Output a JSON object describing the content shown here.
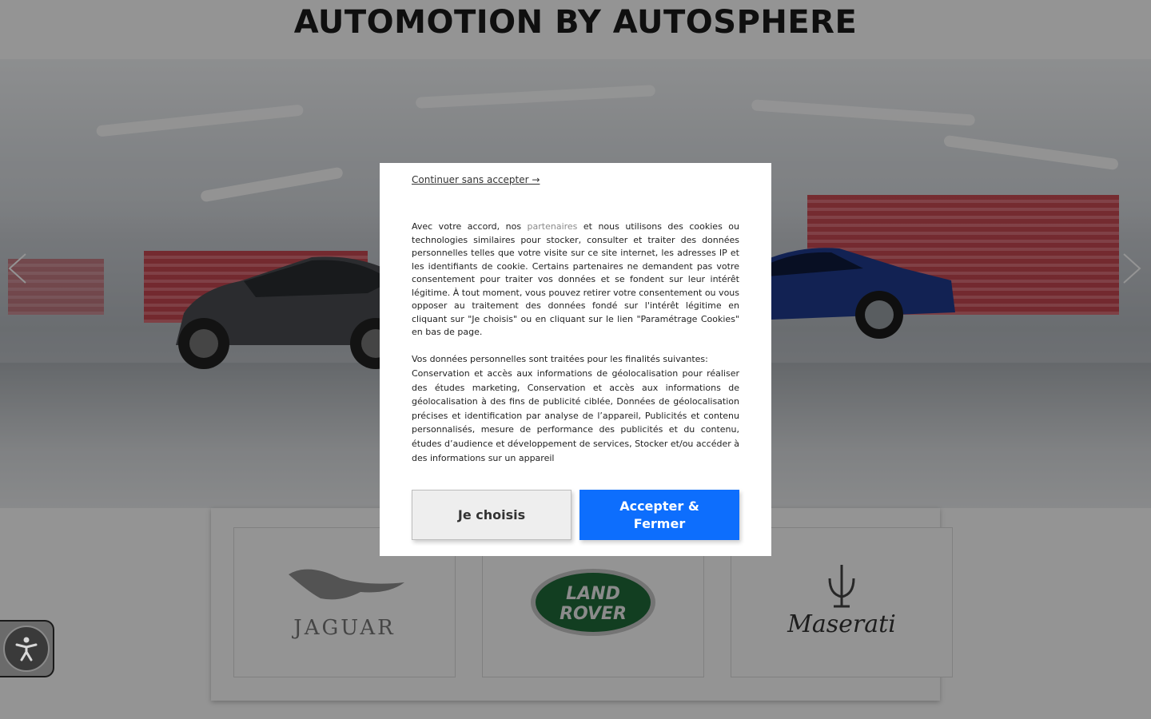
{
  "header": {
    "title": "AUTOMOTION BY AUTOSPHERE"
  },
  "hero": {
    "prev_icon": "chevron-left-icon",
    "next_icon": "chevron-right-icon"
  },
  "brands": [
    {
      "name": "Jaguar",
      "logo_text": "JAGUAR"
    },
    {
      "name": "Land Rover",
      "logo_line1": "LAND",
      "logo_line2": "ROVER"
    },
    {
      "name": "Maserati",
      "logo_text": "Maserati"
    }
  ],
  "accessibility": {
    "icon": "accessibility-icon"
  },
  "cookie_modal": {
    "continue_link": "Continuer sans accepter →",
    "intro_part1": "Avec votre accord, nos ",
    "partners_link": "partenaires",
    "intro_part2": " et nous utilisons des cookies ou technologies similaires pour stocker, consulter et traiter des données personnelles telles que votre visite sur ce site internet, les adresses IP et les identifiants de cookie. Certains partenaires ne demandent pas votre consentement pour traiter vos données et se fondent sur leur intérêt légitime. À tout moment, vous pouvez retirer votre consentement ou vous opposer au traitement des données fondé sur l'intérêt légitime en cliquant sur \"Je choisis\" ou en cliquant sur le lien \"Paramétrage Cookies\" en bas de page.",
    "purposes_title": "Vos données personnelles sont traitées pour les finalités suivantes:",
    "purposes_text": "Conservation et accès aux informations de géolocalisation pour réaliser des études marketing, Conservation et accès aux informations de géolocalisation à des fins de publicité ciblée, Données de géolocalisation précises et identification par analyse de l’appareil, Publicités et contenu personnalisés, mesure de performance des publicités et du contenu, études d’audience et développement de services, Stocker et/ou accéder à des informations sur un appareil",
    "choose_button": "Je choisis",
    "accept_button": "Accepter & Fermer"
  },
  "colors": {
    "accent": "#0d6efd",
    "overlay": "rgba(0,0,0,0.42)"
  }
}
